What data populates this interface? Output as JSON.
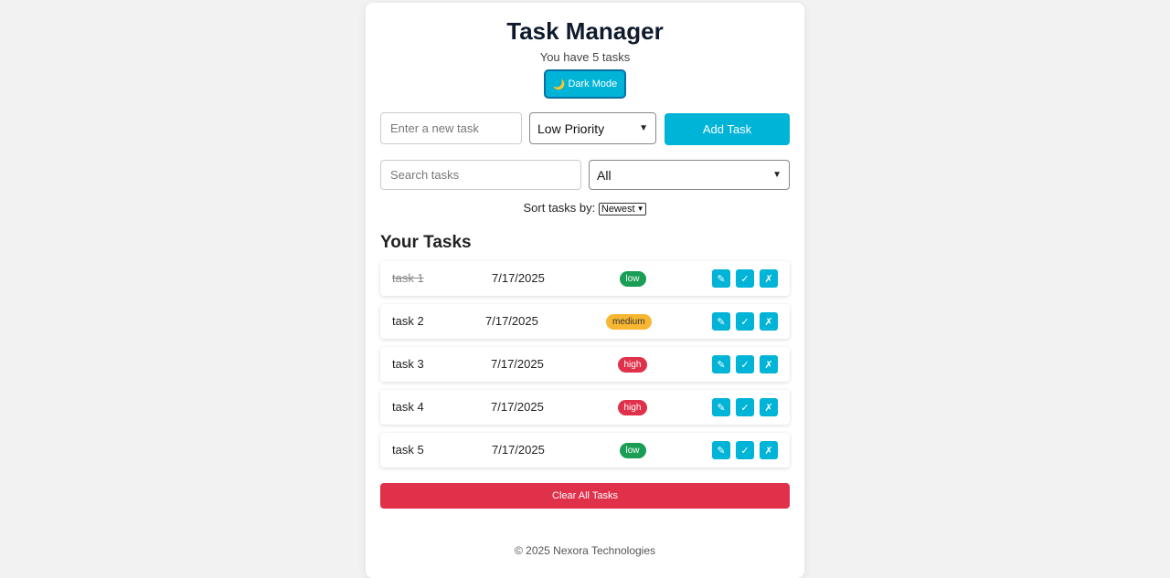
{
  "header": {
    "title": "Task Manager",
    "subtitle": "You have 5 tasks",
    "dark_mode_icon": "🌙",
    "dark_mode_label": "Dark Mode"
  },
  "add_form": {
    "task_placeholder": "Enter a new task",
    "priority_selected": "Low Priority",
    "add_label": "Add Task"
  },
  "filter": {
    "search_placeholder": "Search tasks",
    "status_selected": "All"
  },
  "sort": {
    "label": "Sort tasks by:",
    "selected": "Newest"
  },
  "tasks_section": {
    "title": "Your Tasks"
  },
  "tasks": [
    {
      "name": "task 1",
      "date": "7/17/2025",
      "priority": "low",
      "completed": true
    },
    {
      "name": "task 2",
      "date": "7/17/2025",
      "priority": "medium",
      "completed": false
    },
    {
      "name": "task 3",
      "date": "7/17/2025",
      "priority": "high",
      "completed": false
    },
    {
      "name": "task 4",
      "date": "7/17/2025",
      "priority": "high",
      "completed": false
    },
    {
      "name": "task 5",
      "date": "7/17/2025",
      "priority": "low",
      "completed": false
    }
  ],
  "task_actions": {
    "edit_icon": "✎",
    "complete_icon": "✓",
    "delete_icon": "✗"
  },
  "clear_label": "Clear All Tasks",
  "footer": "© 2025 Nexora Technologies",
  "colors": {
    "accent": "#00b4d8",
    "low": "#1a9e55",
    "medium": "#f7b733",
    "high": "#e0314b",
    "danger": "#e0314b"
  }
}
